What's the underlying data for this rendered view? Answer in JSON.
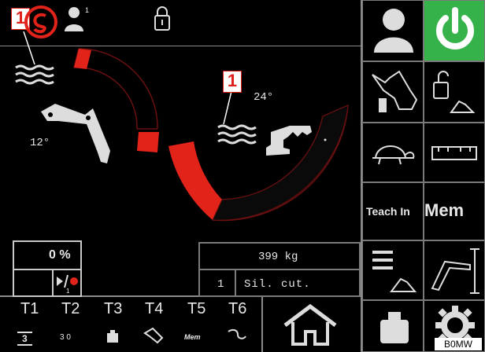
{
  "top_bar": {
    "user_superscript": "1"
  },
  "callouts": {
    "first": "1",
    "second": "1"
  },
  "angles": {
    "upper": "24°",
    "lower": "12°"
  },
  "status": {
    "percent": "0 %",
    "record_sub": "1",
    "weight": "399 kg",
    "row_index": "1",
    "mode_text": "Sil. cut."
  },
  "tools": [
    {
      "label": "T1",
      "num": "1"
    },
    {
      "label": "T2",
      "num": "2"
    },
    {
      "label": "T3",
      "num": "3"
    },
    {
      "label": "T4",
      "num": "4"
    },
    {
      "label": "T5",
      "num": "5"
    },
    {
      "label": "T6",
      "num": "6"
    }
  ],
  "tool_icon_labels": {
    "t1_value": "3",
    "t5_mem": "Mem",
    "t2_value": "3 0"
  },
  "right_panel": {
    "teach_in": "Teach In",
    "mem": "Mem"
  },
  "colors": {
    "accent_red": "#e2231a",
    "power_green": "#35b34a"
  },
  "watermark": "B0MW"
}
